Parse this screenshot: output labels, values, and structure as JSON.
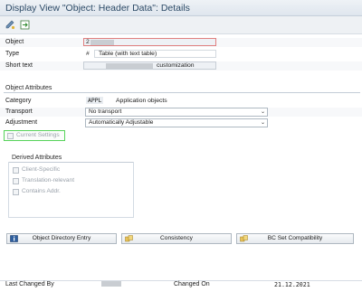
{
  "window": {
    "title": "Display View \"Object: Header Data\": Details"
  },
  "toolbar": {
    "items": [
      {
        "name": "edit-display-toggle-icon"
      },
      {
        "name": "other-entry-icon"
      }
    ]
  },
  "header": {
    "object_label": "Object",
    "object_value": "2",
    "type_label": "Type",
    "type_code": "#",
    "type_text": "Table (with text table)",
    "short_text_label": "Short text",
    "short_text_value": "customization"
  },
  "object_attributes": {
    "title": "Object Attributes",
    "category_label": "Category",
    "category_code": "APPL",
    "category_text": "Application objects",
    "transport_label": "Transport",
    "transport_value": "No transport",
    "adjustment_label": "Adjustment",
    "adjustment_value": "Automatically Adjustable",
    "current_settings_label": "Current Settings"
  },
  "derived_attributes": {
    "title": "Derived Attributes",
    "items": [
      {
        "label": "Client-Specific"
      },
      {
        "label": "Translation-relevant"
      },
      {
        "label": "Contains Addr."
      }
    ]
  },
  "buttons": {
    "object_directory_entry": "Object Directory Entry",
    "consistency": "Consistency",
    "bc_set_compatibility": "BC Set Compatibility"
  },
  "footer": {
    "last_changed_by_label": "Last Changed By",
    "changed_on_label": "Changed On",
    "changed_on_value": "21.12.2021"
  },
  "colors": {
    "title_text": "#2c4a66",
    "highlight_box": "#57d35a",
    "required_border": "#e08080"
  }
}
